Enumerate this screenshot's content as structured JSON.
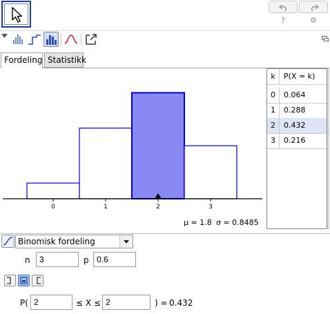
{
  "toolbar": {
    "move_tool_icon": "cursor-arrow-icon",
    "undo_icon": "undo-icon",
    "redo_icon": "redo-icon",
    "help_glyph": "?",
    "settings_glyph": "⚙"
  },
  "viewbar": {
    "buttons": [
      "bar-chart-icon",
      "step-chart-icon",
      "histogram-icon",
      "normal-overlay-icon",
      "export-icon"
    ],
    "selected": "histogram-icon"
  },
  "tabs": [
    {
      "label": "Fordeling",
      "active": true
    },
    {
      "label": "Statistikk",
      "active": false
    }
  ],
  "chart_data": {
    "type": "bar",
    "categories": [
      "0",
      "1",
      "2",
      "3"
    ],
    "values": [
      0.064,
      0.288,
      0.432,
      0.216
    ],
    "highlighted": "2",
    "highlight_color": "#8888f2",
    "ylim": [
      0,
      0.45
    ],
    "grid": false,
    "mean_label": "μ = 1.8",
    "sd_label": "σ = 0.8485"
  },
  "table": {
    "header_k": "k",
    "header_p": "P(X = k)",
    "rows": [
      {
        "k": "0",
        "p": "0.064"
      },
      {
        "k": "1",
        "p": "0.288"
      },
      {
        "k": "2",
        "p": "0.432",
        "selected": true
      },
      {
        "k": "3",
        "p": "0.216"
      }
    ]
  },
  "distribution": {
    "selected": "Binomisk fordeling"
  },
  "params": {
    "n_label": "n",
    "n_value": "3",
    "p_label": "p",
    "p_value": "0.6"
  },
  "probability": {
    "prefix": "P(",
    "lower": "2",
    "middle": "≤ X ≤",
    "upper": "2",
    "suffix": ") =",
    "result": "0.432"
  },
  "colors": {
    "bar_fill": "#8888f2",
    "bar_stroke": "#0000cc",
    "selection_row": "#dde4f6"
  }
}
